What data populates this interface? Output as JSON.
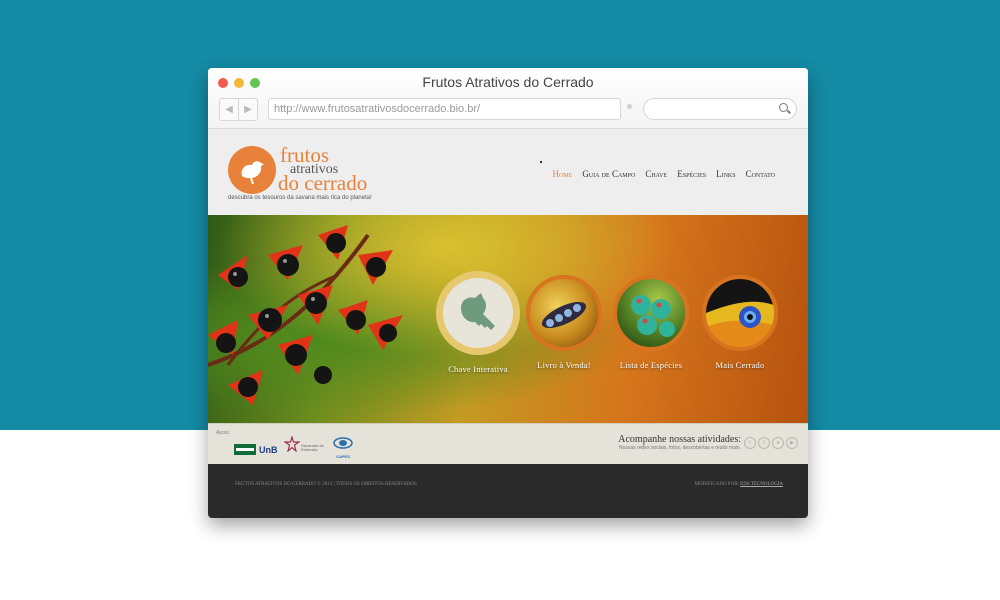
{
  "window": {
    "title": "Frutos Atrativos do Cerrado"
  },
  "toolbar": {
    "back_glyph": "◀",
    "forward_glyph": "▶",
    "url": "http://www.frutosatrativosdocerrado.bio.br/",
    "search_placeholder": ""
  },
  "logo": {
    "line1": "frutos",
    "line2": "atrativos",
    "line3": "do cerrado",
    "tagline": "descubra os tesouros da savana mais rica do planeta!"
  },
  "nav": {
    "items": [
      "Home",
      "Guia de Campo",
      "Chave",
      "Espécies",
      "Links",
      "Contato"
    ],
    "active": "Home"
  },
  "hero": {
    "features": [
      "Chave Interativa",
      "Livro à Venda!",
      "Lista de Espécies",
      "Mais Cerrado"
    ]
  },
  "support": {
    "label": "Apoio:",
    "sponsors": [
      "UnB",
      "Decanato de Extensão",
      "CAPES"
    ],
    "follow_title": "Acompanhe nossas atividades:",
    "follow_sub": "Nossas redes sociais, fotos, descobertas e muito mais."
  },
  "footer": {
    "copyright": "FRUTOS ATRATIVOS DO CERRADO © 2013  |  TODOS OS DIREITOS RESERVADOS",
    "modified_label": "MODIFICADO POR:",
    "modified_by": "EDS TECNOLOGIA"
  },
  "colors": {
    "page_bg": "#148aa4",
    "accent": "#e8823a",
    "footer_bg": "#2a2a2a"
  }
}
